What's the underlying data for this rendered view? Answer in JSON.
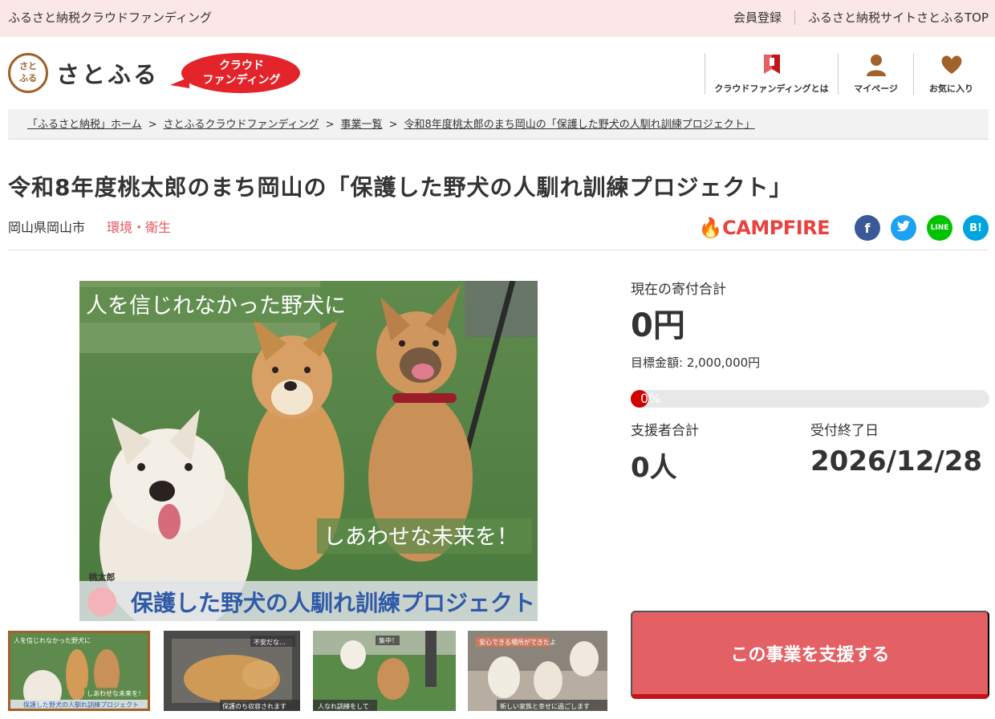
{
  "topbar": {
    "site_name": "ふるさと納税クラウドファンディング",
    "member_register": "会員登録",
    "satofull_top": "ふるさと納税サイトさとふるTOP"
  },
  "header": {
    "logo_mark": "さとふる",
    "logo_text": "さとふる",
    "badge_line1": "クラウド",
    "badge_line2": "ファンディング",
    "nav": {
      "about_cf": "クラウドファンディングとは",
      "mypage": "マイページ",
      "favorites": "お気に入り"
    }
  },
  "breadcrumb": {
    "items": [
      "「ふるさと納税」ホーム",
      "さとふるクラウドファンディング",
      "事業一覧",
      "令和8年度桃太郎のまち岡山の「保護した野犬の人馴れ訓練プロジェクト」"
    ],
    "separator": ">"
  },
  "project": {
    "title": "令和8年度桃太郎のまち岡山の「保護した野犬の人馴れ訓練プロジェクト」",
    "city": "岡山県岡山市",
    "category": "環境・衛生",
    "platform": "CAMPFIRE",
    "share": {
      "facebook": "f",
      "twitter": "t",
      "line": "LINE",
      "hatena": "B!"
    }
  },
  "hero": {
    "caption_top": "人を信じれなかった野犬に",
    "caption_mid": "しあわせな未来を！",
    "caption_bottom": "保護した野犬の人馴れ訓練プロジェクト",
    "logo_text": "桃太郎"
  },
  "thumbnails": [
    {
      "top": "人を信じれなかった野犬に",
      "mid": "しあわせな未来を！",
      "bottom": "保護した野犬の人馴れ訓練プロジェクト"
    },
    {
      "top": "不安だな…",
      "bottom": "保護のち収容されます"
    },
    {
      "top": "集中！",
      "bottom": "人なれ訓練をして"
    },
    {
      "top": "安心できる場所ができたよ",
      "bottom": "新しい家族と幸せに過ごします"
    }
  ],
  "panel": {
    "current_label": "現在の寄付合計",
    "current_amount": "0円",
    "goal": "目標金額: 2,000,000円",
    "progress_percent": 0,
    "progress_label": "0%",
    "supporters_label": "支援者合計",
    "supporters_value": "0人",
    "deadline_label": "受付終了日",
    "deadline_value": "2026/12/28",
    "support_button": "この事業を支援する"
  },
  "colors": {
    "topbar_bg": "#fbe7e7",
    "accent_red": "#e3242b",
    "category_red": "#e3555d",
    "button_bg": "#e36065",
    "progress_fill": "#d10000"
  }
}
